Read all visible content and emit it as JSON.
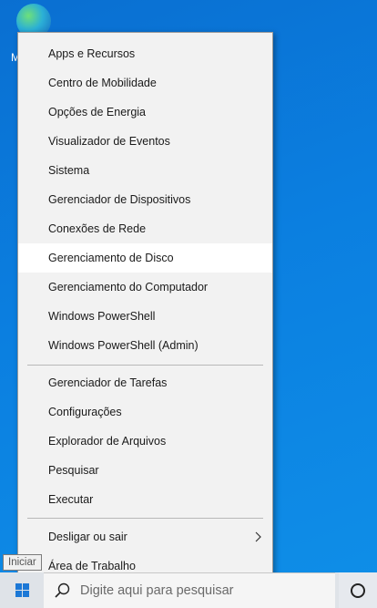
{
  "desktop": {
    "icon_label": "M"
  },
  "menu": {
    "group1": [
      "Apps e Recursos",
      "Centro de Mobilidade",
      "Opções de Energia",
      "Visualizador de Eventos",
      "Sistema",
      "Gerenciador de Dispositivos",
      "Conexões de Rede",
      "Gerenciamento de Disco",
      "Gerenciamento do Computador",
      "Windows PowerShell",
      "Windows PowerShell (Admin)"
    ],
    "group2": [
      "Gerenciador de Tarefas",
      "Configurações",
      "Explorador de Arquivos",
      "Pesquisar",
      "Executar"
    ],
    "group3": [
      "Desligar ou sair",
      "Área de Trabalho"
    ]
  },
  "taskbar": {
    "search_placeholder": "Digite aqui para pesquisar"
  },
  "tooltip": {
    "text": "Iniciar"
  },
  "colors": {
    "accent": "#0b7fe0",
    "menu_bg": "#f2f2f2",
    "highlight": "#ffffff"
  },
  "icons": {
    "browser": "edge-icon",
    "start": "windows-logo-icon",
    "search": "search-icon",
    "cortana": "cortana-circle-icon",
    "submenu": "chevron-right-icon"
  }
}
